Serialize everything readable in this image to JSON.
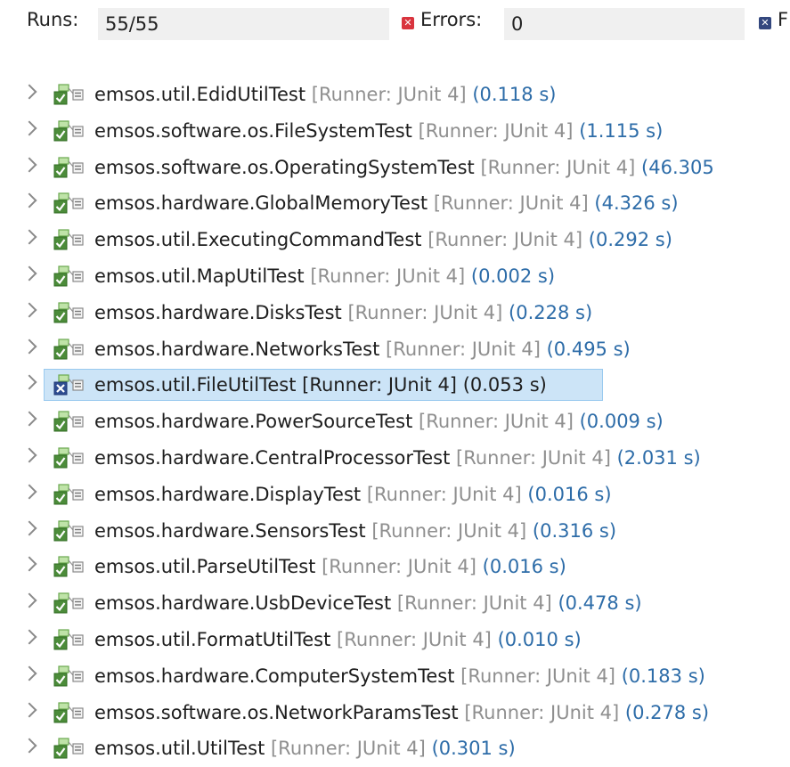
{
  "stats": {
    "runs_label": "Runs:",
    "runs_value": "55/55",
    "errors_label": "Errors:",
    "errors_value": "0",
    "failures_label_visible": "F"
  },
  "colors": {
    "error_icon": "#d9343e",
    "failure_icon": "#33477e",
    "pass_icon": "#4c8c3a",
    "fail_test_icon": "#2e4d92",
    "runner_text": "#8f8f8f",
    "time_text": "#2d6ca8",
    "selection_bg": "#cce4f7"
  },
  "tests": [
    {
      "name": "emsos.util.EdidUtilTest",
      "runner": "[Runner: JUnit 4]",
      "time": "(0.118 s)",
      "status": "passed"
    },
    {
      "name": "emsos.software.os.FileSystemTest",
      "runner": "[Runner: JUnit 4]",
      "time": "(1.115 s)",
      "status": "passed"
    },
    {
      "name": "emsos.software.os.OperatingSystemTest",
      "runner": "[Runner: JUnit 4]",
      "time": "(46.305",
      "status": "passed"
    },
    {
      "name": "emsos.hardware.GlobalMemoryTest",
      "runner": "[Runner: JUnit 4]",
      "time": "(4.326 s)",
      "status": "passed"
    },
    {
      "name": "emsos.util.ExecutingCommandTest",
      "runner": "[Runner: JUnit 4]",
      "time": "(0.292 s)",
      "status": "passed"
    },
    {
      "name": "emsos.util.MapUtilTest",
      "runner": "[Runner: JUnit 4]",
      "time": "(0.002 s)",
      "status": "passed"
    },
    {
      "name": "emsos.hardware.DisksTest",
      "runner": "[Runner: JUnit 4]",
      "time": "(0.228 s)",
      "status": "passed"
    },
    {
      "name": "emsos.hardware.NetworksTest",
      "runner": "[Runner: JUnit 4]",
      "time": "(0.495 s)",
      "status": "passed"
    },
    {
      "name": "emsos.util.FileUtilTest",
      "runner": "[Runner: JUnit 4]",
      "time": "(0.053 s)",
      "status": "failed",
      "selected": true
    },
    {
      "name": "emsos.hardware.PowerSourceTest",
      "runner": "[Runner: JUnit 4]",
      "time": "(0.009 s)",
      "status": "passed"
    },
    {
      "name": "emsos.hardware.CentralProcessorTest",
      "runner": "[Runner: JUnit 4]",
      "time": "(2.031 s)",
      "status": "passed"
    },
    {
      "name": "emsos.hardware.DisplayTest",
      "runner": "[Runner: JUnit 4]",
      "time": "(0.016 s)",
      "status": "passed"
    },
    {
      "name": "emsos.hardware.SensorsTest",
      "runner": "[Runner: JUnit 4]",
      "time": "(0.316 s)",
      "status": "passed"
    },
    {
      "name": "emsos.util.ParseUtilTest",
      "runner": "[Runner: JUnit 4]",
      "time": "(0.016 s)",
      "status": "passed"
    },
    {
      "name": "emsos.hardware.UsbDeviceTest",
      "runner": "[Runner: JUnit 4]",
      "time": "(0.478 s)",
      "status": "passed"
    },
    {
      "name": "emsos.util.FormatUtilTest",
      "runner": "[Runner: JUnit 4]",
      "time": "(0.010 s)",
      "status": "passed"
    },
    {
      "name": "emsos.hardware.ComputerSystemTest",
      "runner": "[Runner: JUnit 4]",
      "time": "(0.183 s)",
      "status": "passed"
    },
    {
      "name": "emsos.software.os.NetworkParamsTest",
      "runner": "[Runner: JUnit 4]",
      "time": "(0.278 s)",
      "status": "passed"
    },
    {
      "name": "emsos.util.UtilTest",
      "runner": "[Runner: JUnit 4]",
      "time": "(0.301 s)",
      "status": "passed"
    }
  ]
}
